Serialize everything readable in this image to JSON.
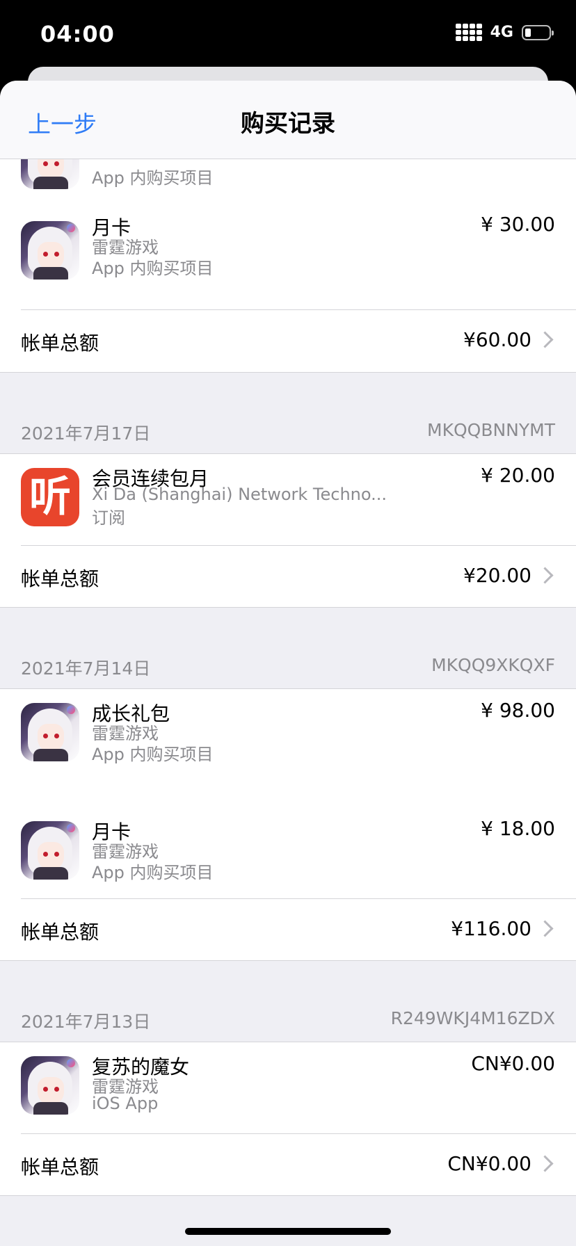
{
  "status_bar": {
    "time": "04:00",
    "network": "4G"
  },
  "nav": {
    "back_label": "上一步",
    "title": "购买记录"
  },
  "top_partial": {
    "sub2": "App 内购买项目"
  },
  "first_section_item": {
    "name": "月卡",
    "sub1": "雷霆游戏",
    "sub2": "App 内购买项目",
    "price": "¥ 30.00"
  },
  "first_section_total": {
    "label": "帐单总额",
    "value": "¥60.00"
  },
  "sections": [
    {
      "date": "2021年7月17日",
      "order_id": "MKQQBNNYMT",
      "items": [
        {
          "name": "会员连续包月",
          "sub1": "Xi Da (Shanghai) Network Techno...",
          "sub2": "订阅",
          "price": "¥ 20.00",
          "icon": "ting-app-icon"
        }
      ],
      "total_label": "帐单总额",
      "total_value": "¥20.00"
    },
    {
      "date": "2021年7月14日",
      "order_id": "MKQQ9XKQXF",
      "items": [
        {
          "name": "成长礼包",
          "sub1": "雷霆游戏",
          "sub2": "App 内购买项目",
          "price": "¥ 98.00",
          "icon": "game-app-icon"
        },
        {
          "name": "月卡",
          "sub1": "雷霆游戏",
          "sub2": "App 内购买项目",
          "price": "¥ 18.00",
          "icon": "game-app-icon"
        }
      ],
      "total_label": "帐单总额",
      "total_value": "¥116.00"
    },
    {
      "date": "2021年7月13日",
      "order_id": "R249WKJ4M16ZDX",
      "items": [
        {
          "name": "复苏的魔女",
          "sub1": "雷霆游戏",
          "sub2": "iOS App",
          "price": "CN¥0.00",
          "icon": "game-app-icon"
        }
      ],
      "total_label": "帐单总额",
      "total_value": "CN¥0.00"
    }
  ],
  "icons": {
    "ting_glyph": "听"
  },
  "colors": {
    "accent": "#2f7cf6",
    "secondary_text": "#8a8a8e",
    "ting_brand": "#e8452c"
  }
}
